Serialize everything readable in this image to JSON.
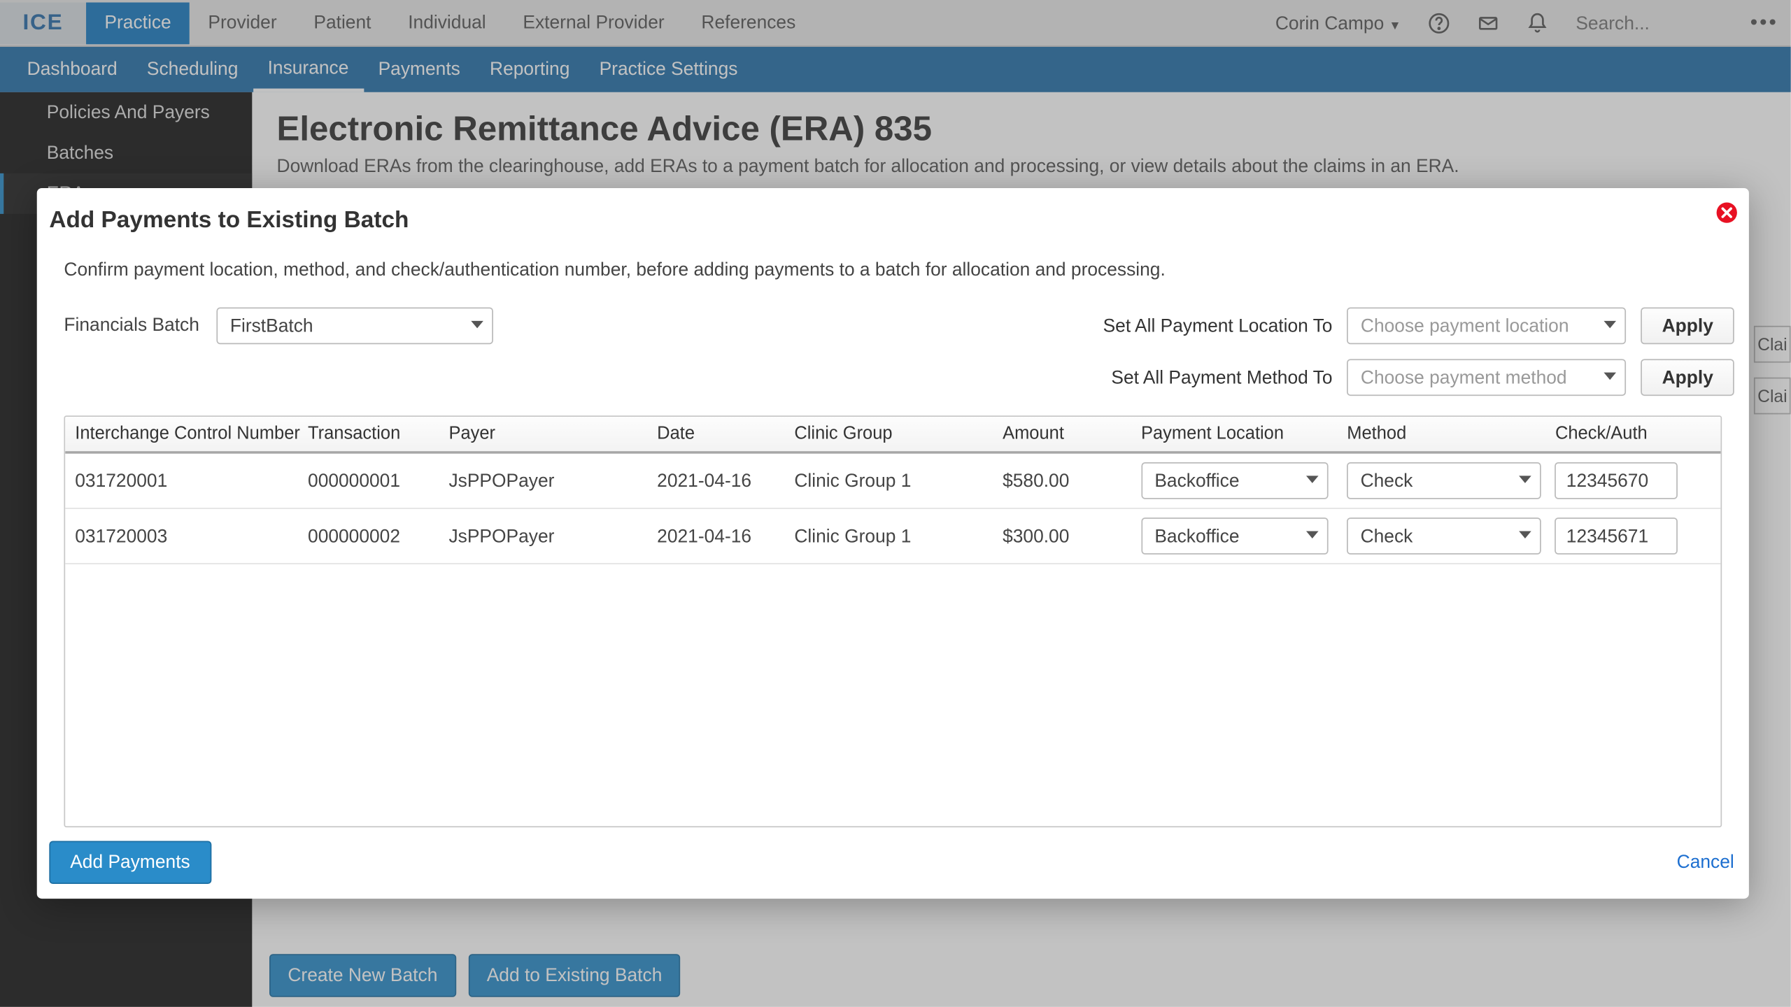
{
  "topnav": {
    "items": [
      "Practice",
      "Provider",
      "Patient",
      "Individual",
      "External Provider",
      "References"
    ],
    "active": 0
  },
  "user": "Corin Campo",
  "search_ph": "Search...",
  "subnav": {
    "items": [
      "Dashboard",
      "Scheduling",
      "Insurance",
      "Payments",
      "Reporting",
      "Practice Settings"
    ],
    "active": 2
  },
  "sidebar": {
    "items": [
      "Policies And Payers",
      "Batches",
      "ERA"
    ],
    "active": 2
  },
  "page": {
    "title": "Electronic Remittance Advice (ERA) 835",
    "desc": "Download ERAs from the clearinghouse, add ERAs to a payment batch for allocation and processing, or view details about the claims in an ERA."
  },
  "bg_buttons": {
    "create": "Create New Batch",
    "add": "Add to Existing Batch"
  },
  "clai": "Clai",
  "modal": {
    "title": "Add Payments to Existing Batch",
    "desc": "Confirm payment location, method, and check/authentication number, before adding payments to a batch for allocation and processing.",
    "fb_label": "Financials Batch",
    "fb_value": "FirstBatch",
    "set_loc_label": "Set All Payment Location To",
    "set_meth_label": "Set All Payment Method To",
    "loc_ph": "Choose payment location",
    "meth_ph": "Choose payment method",
    "apply": "Apply",
    "cols": [
      "Interchange Control Number",
      "Transaction",
      "Payer",
      "Date",
      "Clinic Group",
      "Amount",
      "Payment Location",
      "Method",
      "Check/Auth"
    ],
    "rows": [
      {
        "icn": "031720001",
        "txn": "000000001",
        "payer": "JsPPOPayer",
        "date": "2021-04-16",
        "cg": "Clinic Group 1",
        "amt": "$580.00",
        "loc": "Backoffice",
        "meth": "Check",
        "auth": "12345670"
      },
      {
        "icn": "031720003",
        "txn": "000000002",
        "payer": "JsPPOPayer",
        "date": "2021-04-16",
        "cg": "Clinic Group 1",
        "amt": "$300.00",
        "loc": "Backoffice",
        "meth": "Check",
        "auth": "12345671"
      }
    ],
    "add": "Add Payments",
    "cancel": "Cancel"
  }
}
